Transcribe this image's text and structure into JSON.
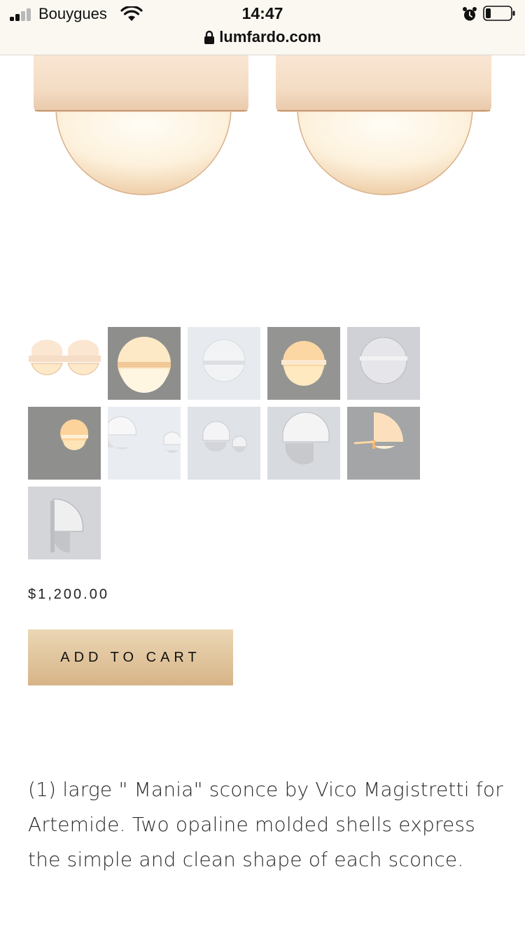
{
  "status_bar": {
    "carrier": "Bouygues",
    "time": "14:47",
    "signal_bars_filled": 2,
    "signal_bars_total": 4,
    "icons": [
      "signal-icon",
      "wifi-icon",
      "alarm-icon",
      "battery-icon"
    ]
  },
  "browser": {
    "url": "lumfardo.com",
    "icon": "lock-icon"
  },
  "product": {
    "hero_image": "pair-of-mania-sconces",
    "thumbnails": [
      {
        "name": "thumb-pair-lit"
      },
      {
        "name": "thumb-single-lit-grey"
      },
      {
        "name": "thumb-white-front"
      },
      {
        "name": "thumb-lit-grey-2"
      },
      {
        "name": "thumb-unlit-grey"
      },
      {
        "name": "thumb-side-lit"
      },
      {
        "name": "thumb-pair-wall"
      },
      {
        "name": "thumb-pair-wall-2"
      },
      {
        "name": "thumb-angle-white"
      },
      {
        "name": "thumb-profile-lit"
      },
      {
        "name": "thumb-profile-white"
      }
    ],
    "price": "$1,200.00",
    "add_to_cart_label": "ADD TO CART",
    "description": "(1) large \" Mania\" sconce by Vico Magistretti for Artemide. Two opaline molded shells express the simple and clean shape of each sconce."
  },
  "colors": {
    "button_gradient_top": "#ebd7b5",
    "button_gradient_bottom": "#d7b487",
    "topbar_background": "#fbf8f1"
  }
}
